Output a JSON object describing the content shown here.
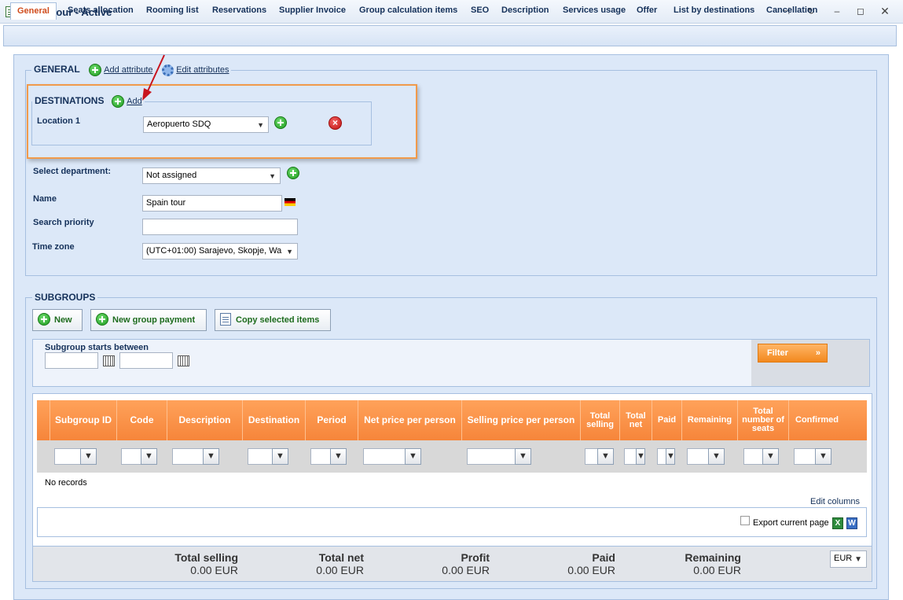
{
  "window": {
    "title": "Spain tour - Active",
    "icon": "list-window-icon"
  },
  "tabs": [
    {
      "label": "General",
      "active": true
    },
    {
      "label": "Seats allocation"
    },
    {
      "label": "Rooming list"
    },
    {
      "label": "Reservations"
    },
    {
      "label": "Supplier Invoice"
    },
    {
      "label": "Group calculation items"
    },
    {
      "label": "SEO"
    },
    {
      "label": "Description"
    },
    {
      "label": "Services usage"
    },
    {
      "label": "Offer"
    },
    {
      "label": "List by destinations"
    },
    {
      "label": "Cancellation"
    }
  ],
  "general": {
    "legend": "GENERAL",
    "add_attribute": "Add attribute",
    "edit_attributes": "Edit attributes"
  },
  "destinations": {
    "legend": "DESTINATIONS",
    "add": "Add",
    "location_label": "Location 1",
    "location_value": "Aeropuerto SDQ"
  },
  "form": {
    "department_label": "Select department:",
    "department_value": "Not assigned",
    "name_label": "Name",
    "name_value": "Spain tour",
    "priority_label": "Search priority",
    "priority_value": "",
    "timezone_label": "Time zone",
    "timezone_value": "(UTC+01:00) Sarajevo, Skopje, Wa"
  },
  "subgroups": {
    "legend": "SUBGROUPS",
    "new_button": "New",
    "payment_button": "New group payment",
    "copy_button": "Copy selected items",
    "filter_label": "Subgroup starts between",
    "filter_button": "Filter",
    "columns": [
      "Subgroup ID",
      "Code",
      "Description",
      "Destination",
      "Period",
      "Net price per person",
      "Selling price per person",
      "Total selling",
      "Total net",
      "Paid",
      "Remaining",
      "Total number of seats",
      "Confirmed"
    ],
    "no_records": "No records",
    "edit_columns": "Edit columns",
    "export_label": "Export current page"
  },
  "totals": {
    "selling_label": "Total selling",
    "selling_value": "0.00 EUR",
    "net_label": "Total net",
    "net_value": "0.00 EUR",
    "profit_label": "Profit",
    "profit_value": "0.00 EUR",
    "paid_label": "Paid",
    "paid_value": "0.00 EUR",
    "remaining_label": "Remaining",
    "remaining_value": "0.00 EUR",
    "currency": "EUR"
  },
  "colors": {
    "accent_orange": "#f6853a",
    "panel_blue": "#dce8f8",
    "highlight_orange": "#f19a4b",
    "annotation_red": "#c8141e"
  }
}
